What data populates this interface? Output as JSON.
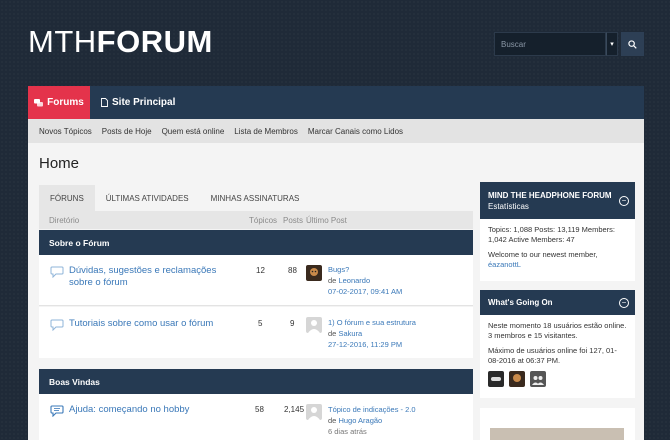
{
  "header": {
    "logo_thin": "MTH",
    "logo_bold": "FORUM",
    "search_placeholder": "Buscar"
  },
  "nav": {
    "forums": "Forums",
    "site": "Site Principal"
  },
  "subnav": [
    "Novos Tópicos",
    "Posts de Hoje",
    "Quem está online",
    "Lista de Membros",
    "Marcar Canais como Lidos"
  ],
  "page_title": "Home",
  "tabs": [
    "FÓRUNS",
    "ÚLTIMAS ATIVIDADES",
    "MINHAS ASSINATURAS"
  ],
  "columns": {
    "dir": "Diretório",
    "topics": "Tópicos",
    "posts": "Posts",
    "last": "Último Post"
  },
  "categories": [
    {
      "name": "Sobre o Fórum",
      "forums": [
        {
          "title": "Dúvidas, sugestões e reclamações sobre o fórum",
          "topics": "12",
          "posts": "88",
          "last_title": "Bugs?",
          "last_by": "de",
          "last_user": "Leonardo",
          "last_date": "07-02-2017, 09:41 AM"
        },
        {
          "title": "Tutoriais sobre como usar o fórum",
          "topics": "5",
          "posts": "9",
          "last_title": "1) O fórum e sua estrutura",
          "last_by": "de",
          "last_user": "Sakura",
          "last_date": "27-12-2016, 11:29 PM"
        }
      ]
    },
    {
      "name": "Boas Vindas",
      "forums": [
        {
          "title": "Ajuda: começando no hobby",
          "topics": "58",
          "posts": "2,145",
          "last_title": "Tópico de indicações - 2.0",
          "last_by": "de",
          "last_user": "Hugo Aragão",
          "last_date": "6 dias atrás"
        }
      ]
    }
  ],
  "sidebar": {
    "stats": {
      "title": "MIND THE HEADPHONE FORUM",
      "subtitle": "Estatísticas",
      "line1": "Topics: 1,088   Posts: 13,119   Members: 1,042   Active Members: 47",
      "welcome": "Welcome to our newest member,",
      "newest": "éazanottL"
    },
    "going_on": {
      "title": "What's Going On",
      "line1": "Neste momento 18 usuários estão online. 3 membros e 15 visitantes.",
      "line2": "Máximo de usuários online foi 127, 01-08-2016 at 06:37 PM."
    }
  },
  "colors": {
    "accent": "#e4334b",
    "navy": "#253a52",
    "link": "#3a78b8"
  }
}
